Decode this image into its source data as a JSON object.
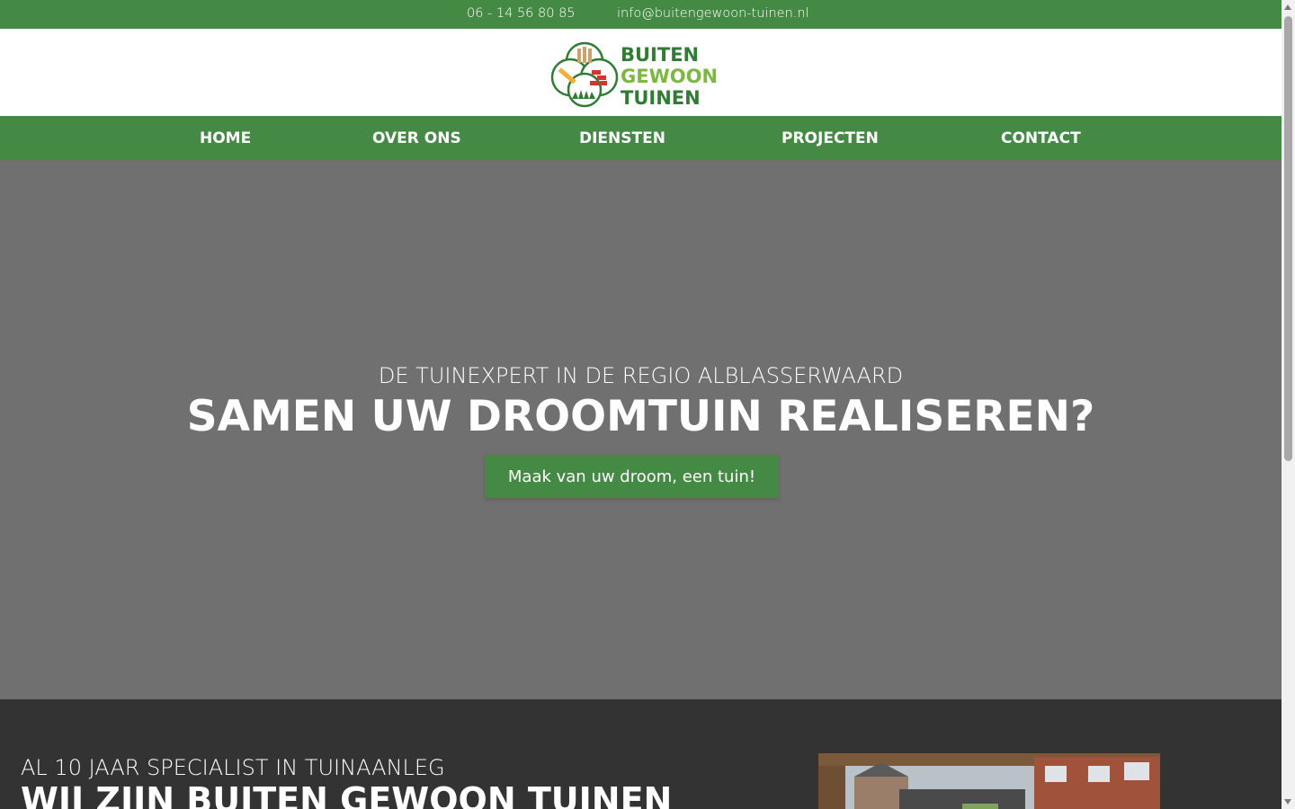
{
  "topbar": {
    "phone": "06 - 14 56 80 85",
    "email": "info@buitengewoon-tuinen.nl"
  },
  "logo": {
    "line1": "BUITEN",
    "line2": "GEWOON",
    "line3": "TUINEN"
  },
  "nav": {
    "items": [
      {
        "label": "HOME"
      },
      {
        "label": "OVER ONS"
      },
      {
        "label": "DIENSTEN"
      },
      {
        "label": "PROJECTEN"
      },
      {
        "label": "CONTACT"
      }
    ]
  },
  "hero": {
    "kicker": "DE TUINEXPERT IN DE REGIO ALBLASSERWAARD",
    "headline": "SAMEN UW DROOMTUIN REALISEREN?",
    "cta_label": "Maak van uw droom, een tuin!"
  },
  "about": {
    "subtitle": "AL 10 JAAR SPECIALIST IN TUINAANLEG",
    "title": "WIJ ZIJN BUITEN GEWOON TUINEN"
  },
  "colors": {
    "brand_green": "#458a44",
    "hero_gray": "#707070",
    "dark_section": "#333333",
    "logo_dark_green": "#2f7d33",
    "logo_light_green": "#7ab93c"
  }
}
